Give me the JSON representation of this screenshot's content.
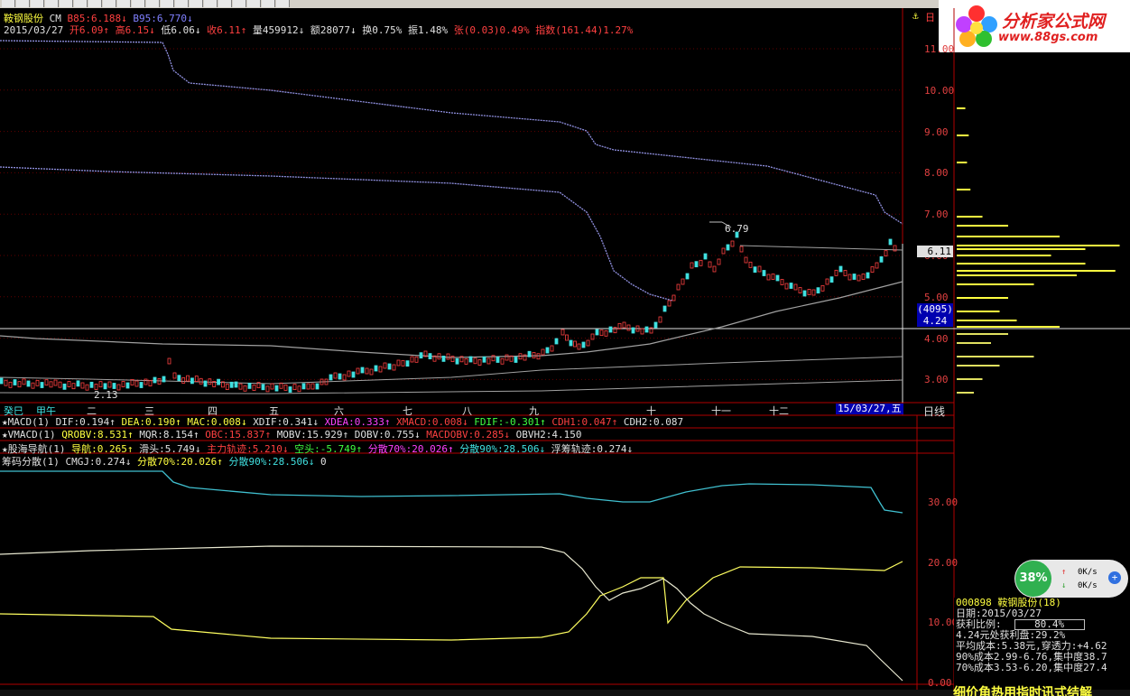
{
  "stock": {
    "name": "鞍钢股份",
    "code_tag": "CM",
    "b85": "B85:6.188",
    "b95": "B95:6.770",
    "date": "2015/03/27",
    "open": "开6.09",
    "high": "高6.15",
    "low": "低6.06",
    "close": "收6.11",
    "volume": "量459912",
    "amount": "额28077",
    "turnover": "换0.75%",
    "amplitude": "振1.48%",
    "change": "张(0.03)0.49%",
    "index": "指数(161.44)1.27%"
  },
  "price_axis": [
    "11.00",
    "10.00",
    "9.00",
    "8.00",
    "7.00",
    "6.00",
    "5.00",
    "4.00",
    "3.00"
  ],
  "price_marker": "6.11",
  "cursor_box": {
    "count": "(4095)",
    "price": "4.24"
  },
  "peak_label": "6.79",
  "low_label": "2.13",
  "months": [
    "癸巳",
    "甲午",
    "二",
    "三",
    "四",
    "五",
    "六",
    "七",
    "八",
    "九",
    "十",
    "十一",
    "十二"
  ],
  "date_badge": "15/03/27,五",
  "period": "日线",
  "indicators": {
    "macd": {
      "title": "MACD(1)",
      "dif": "DIF:0.194",
      "dea": "DEA:0.190",
      "mac": "MAC:0.008",
      "xdif": "XDIF:0.341",
      "xdea": "XDEA:0.333",
      "xmacd": "XMACD:0.008",
      "fdif": "FDIF:-0.301",
      "cdh1": "CDH1:0.047",
      "cdh2": "CDH2:0.087"
    },
    "vmacd": {
      "title": "VMACD(1)",
      "qrobv": "QROBV:8.531",
      "mqr": "MQR:8.154",
      "obc": "OBC:15.837",
      "mobv": "MOBV:15.929",
      "dobv": "DOBV:0.755",
      "macdobv": "MACDOBV:0.285",
      "obvh2": "OBVH2:4.150"
    },
    "guhai": {
      "title": "股海导航(1)",
      "dh": "导航:0.265",
      "dt": "滑头:5.749",
      "zl": "主力轨迹:5.210",
      "kt": "空头:-5.749",
      "fs70": "分散70%:20.026",
      "fs90": "分散90%:28.506",
      "fc": "浮筹轨迹:0.274"
    },
    "chouma": {
      "title": "筹码分散(1)",
      "cmgj": "CMGJ:0.274",
      "fs70": "分散70%:20.026",
      "fs90": "分散90%:28.506",
      "zero": "0"
    }
  },
  "lower_axis": [
    "30.00",
    "20.00",
    "10.00",
    "0.00"
  ],
  "widget": {
    "percent": "38%",
    "up": "0K/s",
    "down": "0K/s"
  },
  "info": {
    "line1": "000898 鞍钢股份(18)",
    "line2": "日期:2015/03/27",
    "line3_label": "获利比例:",
    "line3_value": "80.4%",
    "line4": "4.24元处获利盘:29.2%",
    "line5": "平均成本:5.38元,穿透力:+4.62",
    "line6": "90%成本2.99-6.76,集中度38.7",
    "line7": "70%成本3.53-6.20,集中度27.4"
  },
  "logo": {
    "title": "分析家公式网",
    "url": "www.88gs.com"
  },
  "bottom_banner": "细价角热用指时讯式结解",
  "colors": {
    "accent_red": "#b00000",
    "yellow": "#ffff40",
    "cyan": "#40c0d0"
  }
}
